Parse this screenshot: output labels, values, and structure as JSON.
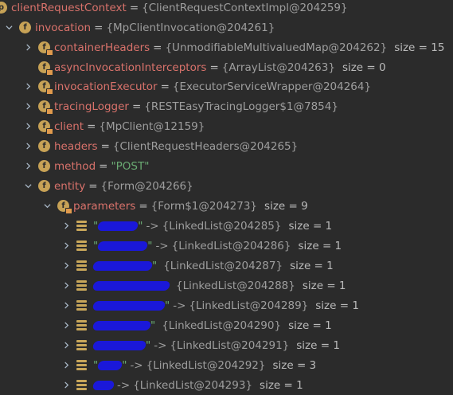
{
  "rows": [
    {
      "arrow": "",
      "icon": "p",
      "name": "clientRequestContext",
      "value": "{ClientRequestContextImpl@204259}"
    },
    {
      "arrow": "down",
      "icon": "f",
      "name": "invocation",
      "value": "{MpClientInvocation@204261}"
    },
    {
      "arrow": "right",
      "icon": "f",
      "name": "containerHeaders",
      "value": "{UnmodifiableMultivaluedMap@204262}",
      "size": "size = 15"
    },
    {
      "arrow": "",
      "icon": "f",
      "name": "asyncInvocationInterceptors",
      "value": "{ArrayList@204263}",
      "size": "size = 0"
    },
    {
      "arrow": "right",
      "icon": "f",
      "name": "invocationExecutor",
      "value": "{ExecutorServiceWrapper@204264}"
    },
    {
      "arrow": "right",
      "icon": "f",
      "name": "tracingLogger",
      "value": "{RESTEasyTracingLogger$1@7854}"
    },
    {
      "arrow": "right",
      "icon": "f",
      "name": "client",
      "value": "{MpClient@12159}"
    },
    {
      "arrow": "right",
      "icon": "f",
      "name": "headers",
      "value": "{ClientRequestHeaders@204265}"
    },
    {
      "arrow": "right",
      "icon": "f",
      "name": "method",
      "value": "\"POST\""
    },
    {
      "arrow": "down",
      "icon": "f",
      "name": "entity",
      "value": "{Form@204266}"
    },
    {
      "arrow": "down",
      "icon": "f",
      "name": "parameters",
      "value": "{Form$1@204273}",
      "size": "size = 9"
    }
  ],
  "entries": [
    {
      "key_visible": "\"",
      "key_tail": "\"",
      "value": "{LinkedList@204285}",
      "size": "size = 1"
    },
    {
      "key_visible": "\"",
      "key_tail": "\"",
      "value": "{LinkedList@204286}",
      "size": "size = 1"
    },
    {
      "key_visible": "",
      "key_tail": "\"",
      "value": "{LinkedList@204287}",
      "size": "size = 1"
    },
    {
      "key_visible": "",
      "key_tail": "",
      "value": "{LinkedList@204288}",
      "size": "size = 1"
    },
    {
      "key_visible": "",
      "key_tail": "\"",
      "value": "{LinkedList@204289}",
      "size": "size = 1"
    },
    {
      "key_visible": "",
      "key_tail": "\"",
      "value": "{LinkedList@204290}",
      "size": "size = 1"
    },
    {
      "key_visible": "",
      "key_tail": "\"",
      "value": "{LinkedList@204291}",
      "size": "size = 1"
    },
    {
      "key_visible": "\"",
      "key_tail": "\"",
      "value": "{LinkedList@204292}",
      "size": "size = 3"
    },
    {
      "key_visible": "",
      "key_tail": "",
      "value": "{LinkedList@204293}",
      "size": "size = 1"
    }
  ],
  "arrow_symbol": "->",
  "equals_symbol": "="
}
